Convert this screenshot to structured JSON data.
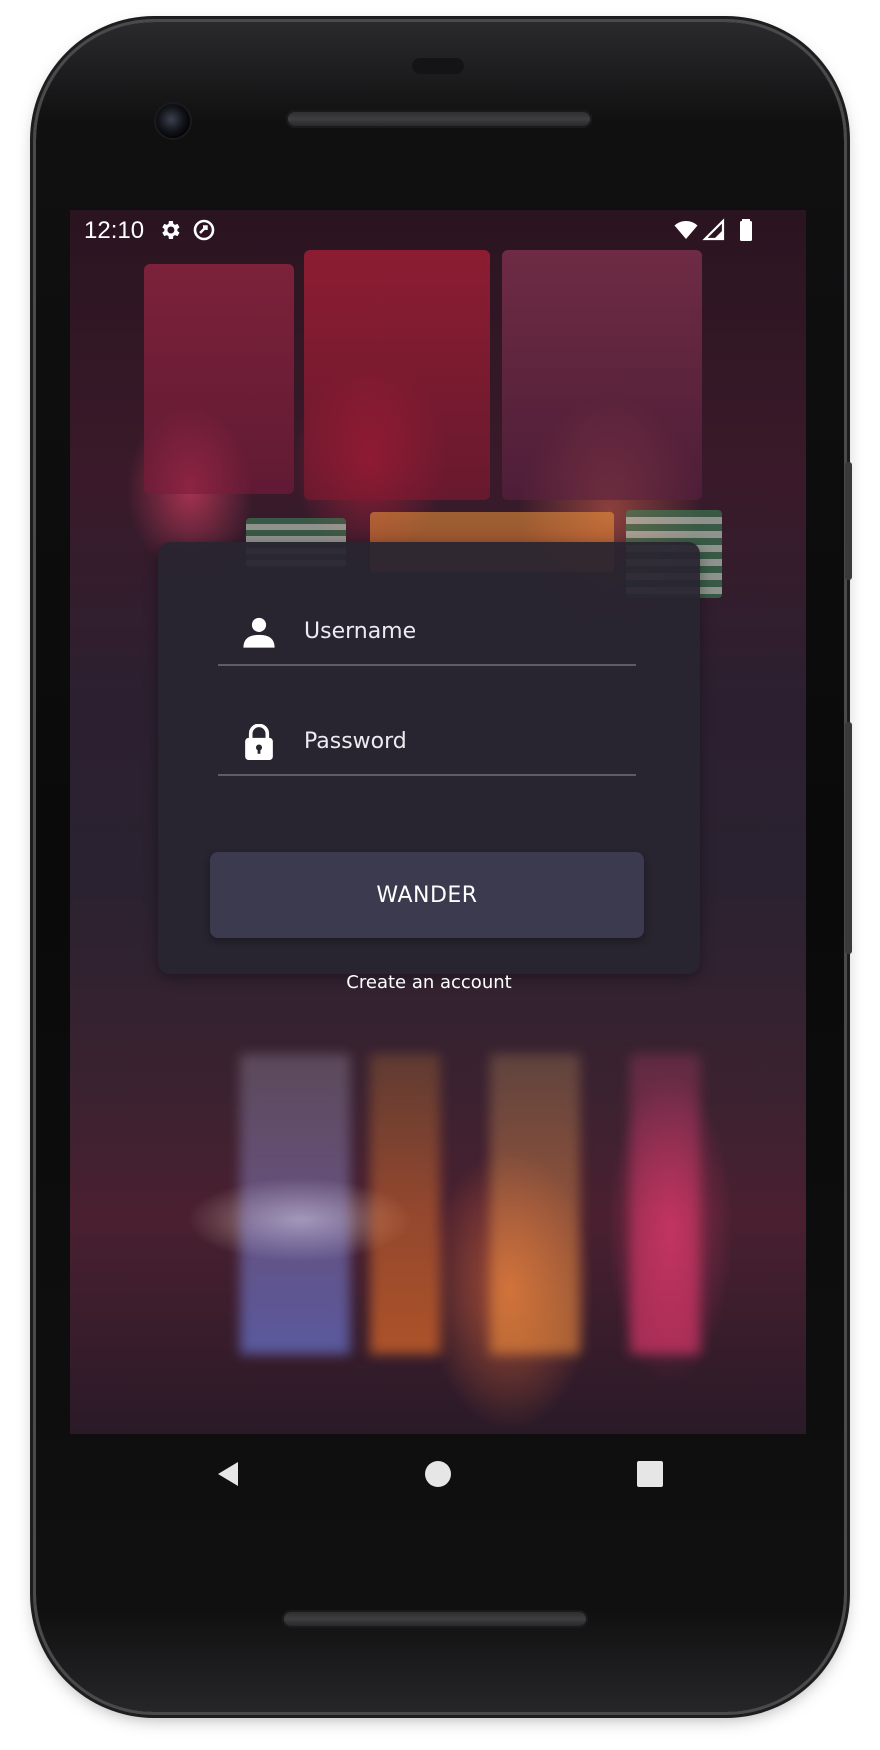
{
  "status_bar": {
    "time": "12:10",
    "icons": [
      "settings-icon",
      "sync-icon",
      "wifi-icon",
      "cell-signal-icon",
      "battery-icon"
    ]
  },
  "login": {
    "username_placeholder": "Username",
    "password_placeholder": "Password",
    "submit_label": "WANDER",
    "create_account_label": "Create an account"
  },
  "navigation": {
    "buttons": [
      "back-icon",
      "home-icon",
      "recents-icon"
    ]
  },
  "colors": {
    "card_background": "#282530",
    "button_background": "#3b3a4e",
    "text": "#ffffff"
  }
}
